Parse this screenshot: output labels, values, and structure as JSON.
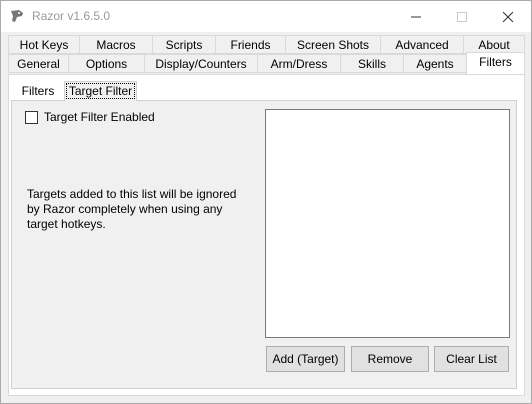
{
  "window": {
    "title": "Razor v1.6.5.0"
  },
  "tabs_row1": [
    "Hot Keys",
    "Macros",
    "Scripts",
    "Friends",
    "Screen Shots",
    "Advanced",
    "About"
  ],
  "tabs_row2": [
    "General",
    "Options",
    "Display/Counters",
    "Arm/Dress",
    "Skills",
    "Agents",
    "Filters"
  ],
  "active_tab": "Filters",
  "subtabs": [
    "Filters",
    "Target Filter"
  ],
  "active_subtab": "Target Filter",
  "target_filter": {
    "enabled_label": "Target Filter Enabled",
    "enabled": false,
    "info_text": "Targets added to this list will be ignored by Razor completely when using any target hotkeys.",
    "list_items": [],
    "add_label": "Add (Target)",
    "remove_label": "Remove",
    "clear_label": "Clear List"
  }
}
